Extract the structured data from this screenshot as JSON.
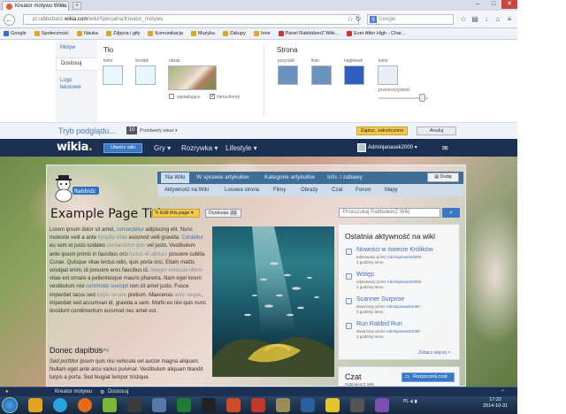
{
  "browser": {
    "tab_title": "Kreator motywu Wikia",
    "url_prefix": "pl.rabbidzerz.",
    "url_domain": "wikia.com",
    "url_rest": "/wiki/Specjalna:Kreator_motywu",
    "search_placeholder": "Google",
    "search_engine_icon": "g-icon",
    "bookmarks": [
      "Google",
      "Społeczność",
      "Nauka",
      "Zdjęcia i gify",
      "Komunikacja",
      "Muzyka",
      "Zakupy",
      "Inne",
      "Panel RabbidzerZ Wiki...",
      "Ever After High - Char..."
    ]
  },
  "theme_designer": {
    "tabs": [
      "Motyw",
      "Dostosuj",
      "Logo tekstowe"
    ],
    "active_tab": "Dostosuj",
    "background": {
      "heading": "Tło",
      "color_label": "kolor",
      "middle_label": "środek",
      "image_label": "obraz",
      "tile_label": "sąsiadująco",
      "fixed_label": "nieruchomy",
      "color": "#e6f8fb",
      "middle": "#e6f8fb"
    },
    "page": {
      "heading": "Strona",
      "buttons_label": "przyciski",
      "links_label": "linki",
      "header_label": "nagłówek",
      "color_label": "kolor",
      "transparency_label": "przezroczystość",
      "buttons": "#6b93bd",
      "links": "#6b93bd",
      "header": "#2f5fc0",
      "color": "#e9eef4"
    }
  },
  "preview_bar": {
    "label": "Tryb podglądu...",
    "badge": "10",
    "select": "Przedawny wiesz",
    "save": "Zapisz, zakończono",
    "cancel": "Anuluj"
  },
  "wikia_header": {
    "logo": "wikia",
    "start_button": "Utwórz wiki",
    "nav": [
      "Gry",
      "Rozrywka",
      "Lifestyle"
    ],
    "user": "Adminjanasek2000"
  },
  "wiki_nav": {
    "tabs": [
      "Na Wiki",
      "W sprawie artykułów",
      "Kategorie artykułów",
      "Info. i zabawy"
    ],
    "subtabs": [
      "Aktywność na Wiki",
      "Losowa strona",
      "Filmy",
      "Obrazy",
      "Czat",
      "Forum",
      "Mapy"
    ],
    "share": "Dodaj"
  },
  "article": {
    "title": "Example Page Title",
    "edit": "Edit this page",
    "talk": "Dyskusja",
    "talk_count": "23",
    "search_placeholder": "Przeszukaj RabbideerZ Wiki",
    "para1_a": "Lorem ipsum dolor sit amet, ",
    "para1_link1": "consectetur",
    "para1_b": " adipiscing elit. Nunc molestie velit a ante ",
    "para1_link2": "fringilla vitae",
    "para1_c": " euismod velit gravida. ",
    "para1_link3": "Curabitur",
    "para1_d": " eu sem et justo sodales ",
    "para1_link4": "consectetur quis",
    "para1_e": " vel justo. Vestibulum ante ipsum primis in faucibus orci ",
    "para1_link5": "luctus et ultrices",
    "para1_f": " posuere cubilia Curae. Quisque vitae lectus odio, quis porta orci. Etiam mattis volutpat enim, id posuere eros faucibus id. ",
    "para1_link6": "Integer vehicula libero",
    "para1_g": " vitae est ornare a pellentesque mauris pharetra. Nam eget lorem vestibulum nisi ",
    "para1_link7": "commodo suscipit",
    "para1_h": " non sit amet justo. Fusce imperdiet lacus sed ",
    "para1_link8": "turpis ornare",
    "para1_i": " pretium. ",
    "para1_em": "Maecenas",
    "para1_link9": "ante neque",
    "para1_j": ", imperdiet sed accumsan id, gravida a sem. Morbi eu nisi quis nunc tincidunt condimentum euismod nec amet est.",
    "section2": "Donec dapibus",
    "section2_edit": "Edytuj",
    "para2_link1": "Sed porttitor ipsum",
    "para2_a": " quis nisi vehicula vel ",
    "para2_link2": "auctor magna",
    "para2_b": " aliquam. Nullam eget ante arcu ",
    "para2_link3": "varius",
    "para2_c": " pulvinar. Vestibulum aliquam ",
    "para2_link4": "blandit turpis",
    "para2_d": " a porta. Sed feugiat tempor tristique."
  },
  "activity": {
    "title": "Ostatnia aktywność na wiki",
    "items": [
      {
        "title": "Nowości w świecie Królików",
        "meta": "edytowany przez",
        "user": "Adminjanasek2000",
        "time": "3 godziny temu"
      },
      {
        "title": "Wstęp",
        "meta": "edytowany przez",
        "user": "Adminjanasek2000",
        "time": "3 godziny temu"
      },
      {
        "title": "Scanner Surprise",
        "meta": "stworzony przez",
        "user": "Adminjanasek2000",
        "time": "3 godziny temu"
      },
      {
        "title": "Run Rabbid Run",
        "meta": "stworzony przez",
        "user": "Adminjanasek2000",
        "time": "3 godziny temu"
      }
    ],
    "more": "Zobacz więcej >"
  },
  "chat": {
    "title": "Czat",
    "button": "Rozpocznij czat",
    "sub": "RabbideerZ Wiki"
  },
  "wikia_bar": {
    "item1": "Kreator motywu",
    "item2": "Dostosuj"
  },
  "taskbar": {
    "lang": "PL",
    "time": "17:22",
    "date": "2014-10-31"
  },
  "colors": {
    "wikia_navy": "#1b2f50",
    "accent_blue": "#3b78c4",
    "yellow": "#f2c94c"
  }
}
